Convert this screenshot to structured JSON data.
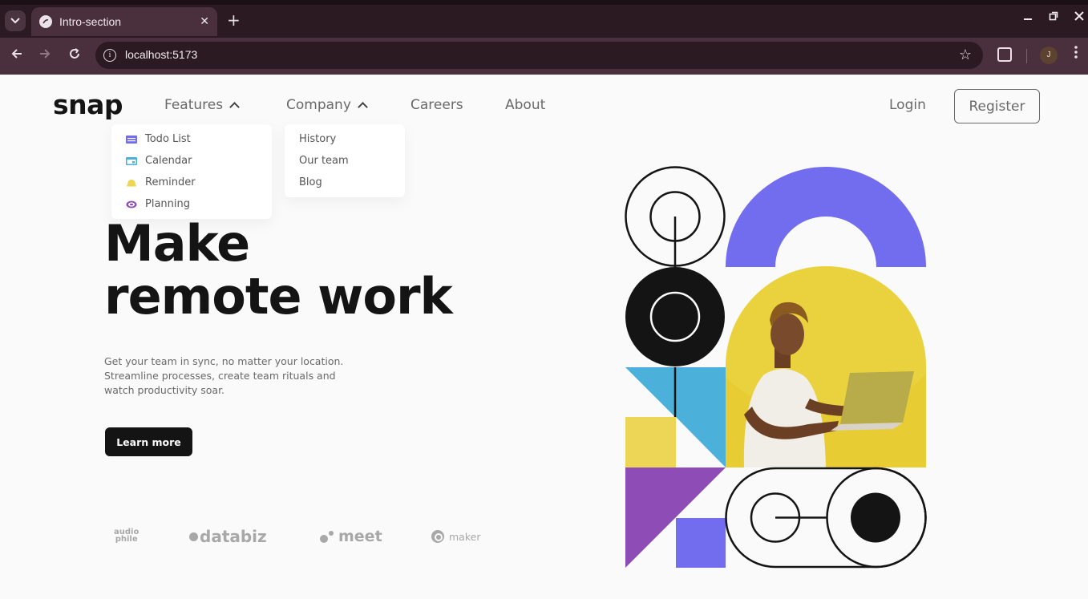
{
  "browser": {
    "tab_title": "Intro-section",
    "url": "localhost:5173",
    "profile_initial": "J"
  },
  "site": {
    "logo": "snap",
    "nav": {
      "features": "Features",
      "company": "Company",
      "careers": "Careers",
      "about": "About",
      "login": "Login",
      "register": "Register"
    },
    "features_menu": [
      {
        "label": "Todo List",
        "icon": "todo-icon",
        "color": "#726cee"
      },
      {
        "label": "Calendar",
        "icon": "calendar-icon",
        "color": "#4bb1da"
      },
      {
        "label": "Reminder",
        "icon": "reminder-icon",
        "color": "#edd556"
      },
      {
        "label": "Planning",
        "icon": "planning-icon",
        "color": "#8e4cb6"
      }
    ],
    "company_menu": [
      {
        "label": "History"
      },
      {
        "label": "Our team"
      },
      {
        "label": "Blog"
      }
    ],
    "hero": {
      "title_line1": "Make",
      "title_line2": "remote work",
      "description": "Get your team in sync, no matter your location. Streamline processes, create team rituals and watch productivity soar.",
      "cta": "Learn more"
    },
    "clients": {
      "audiophile_top": "audio",
      "audiophile_bottom": "phile",
      "databiz": "databiz",
      "meet": "meet",
      "maker": "maker"
    },
    "colors": {
      "purple": "#726cee",
      "blue": "#4bb1da",
      "yellow": "#edd556",
      "violet": "#8e4cb6",
      "dark": "#141414"
    }
  }
}
